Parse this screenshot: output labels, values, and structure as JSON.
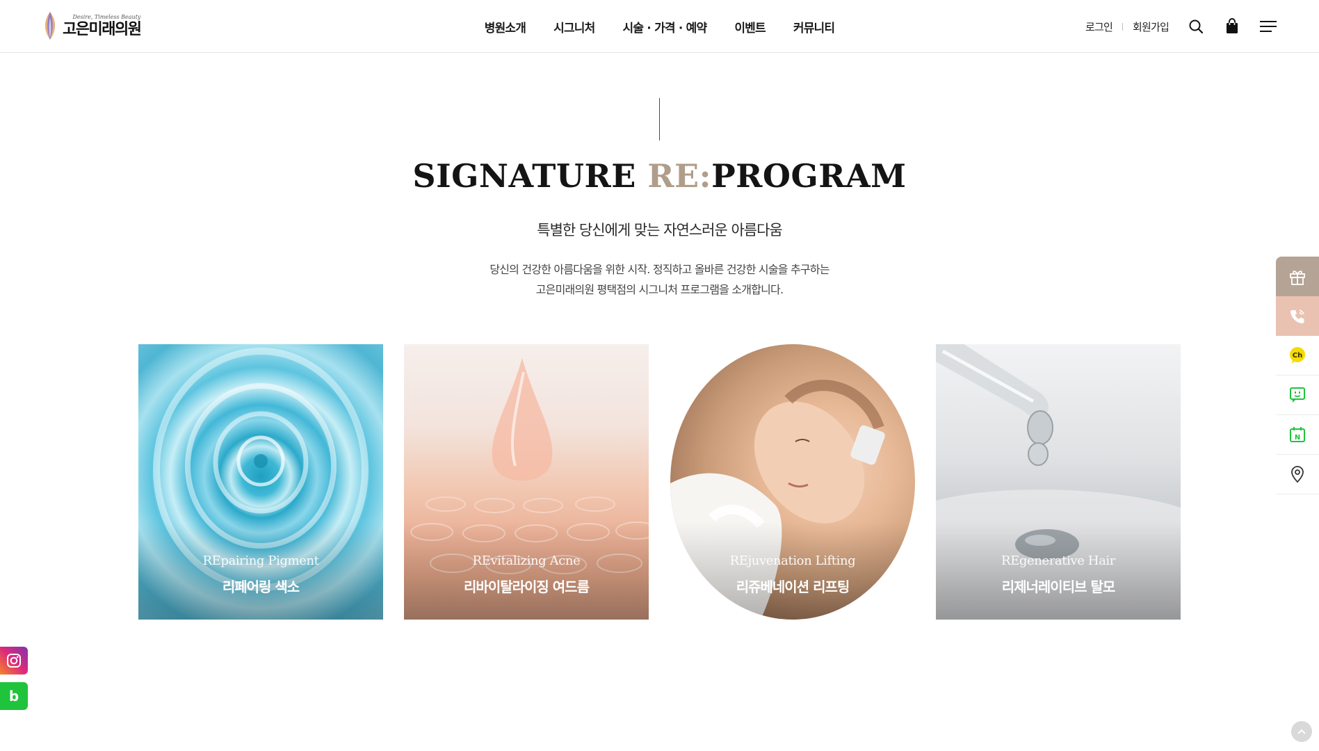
{
  "brand": {
    "tagline": "Desire, Timeless Beauty",
    "name": "고은미래의원"
  },
  "nav": {
    "items": [
      "병원소개",
      "시그니처",
      "시술 · 가격 · 예약",
      "이벤트",
      "커뮤니티"
    ]
  },
  "util": {
    "login": "로그인",
    "signup": "회원가입"
  },
  "hero": {
    "title_main": "SIGNATURE ",
    "title_accent": "RE:",
    "title_end": "PROGRAM",
    "subtitle": "특별한 당신에게 맞는 자연스러운 아름다움",
    "desc_line1": "당신의 건강한 아름다움을 위한 시작. 정직하고 올바른 건강한 시술을 추구하는",
    "desc_line2": "고은미래의원 평택점의 시그니처 프로그램을 소개합니다."
  },
  "cards": [
    {
      "en": "REpairing Pigment",
      "ko": "리페어링 색소"
    },
    {
      "en": "REvitalizing Acne",
      "ko": "리바이탈라이징 여드름"
    },
    {
      "en": "REjuvenation Lifting",
      "ko": "리쥬베네이션 리프팅"
    },
    {
      "en": "REgenerative Hair",
      "ko": "리제너레이티브 탈모"
    }
  ],
  "quickbar": {
    "icons": [
      "gift-icon",
      "phone-icon",
      "kakao-channel-icon",
      "talk-icon",
      "naver-booking-icon",
      "location-icon"
    ],
    "kakao_label": "Ch",
    "naver_label": "N"
  },
  "social": {
    "instagram": "instagram-icon",
    "blog_label": "b"
  },
  "colors": {
    "accent": "#b09d8a",
    "gift_bg": "#b5a396",
    "call_bg": "#eac2b1",
    "kakao": "#f5dc00",
    "naver": "#20c33c"
  }
}
